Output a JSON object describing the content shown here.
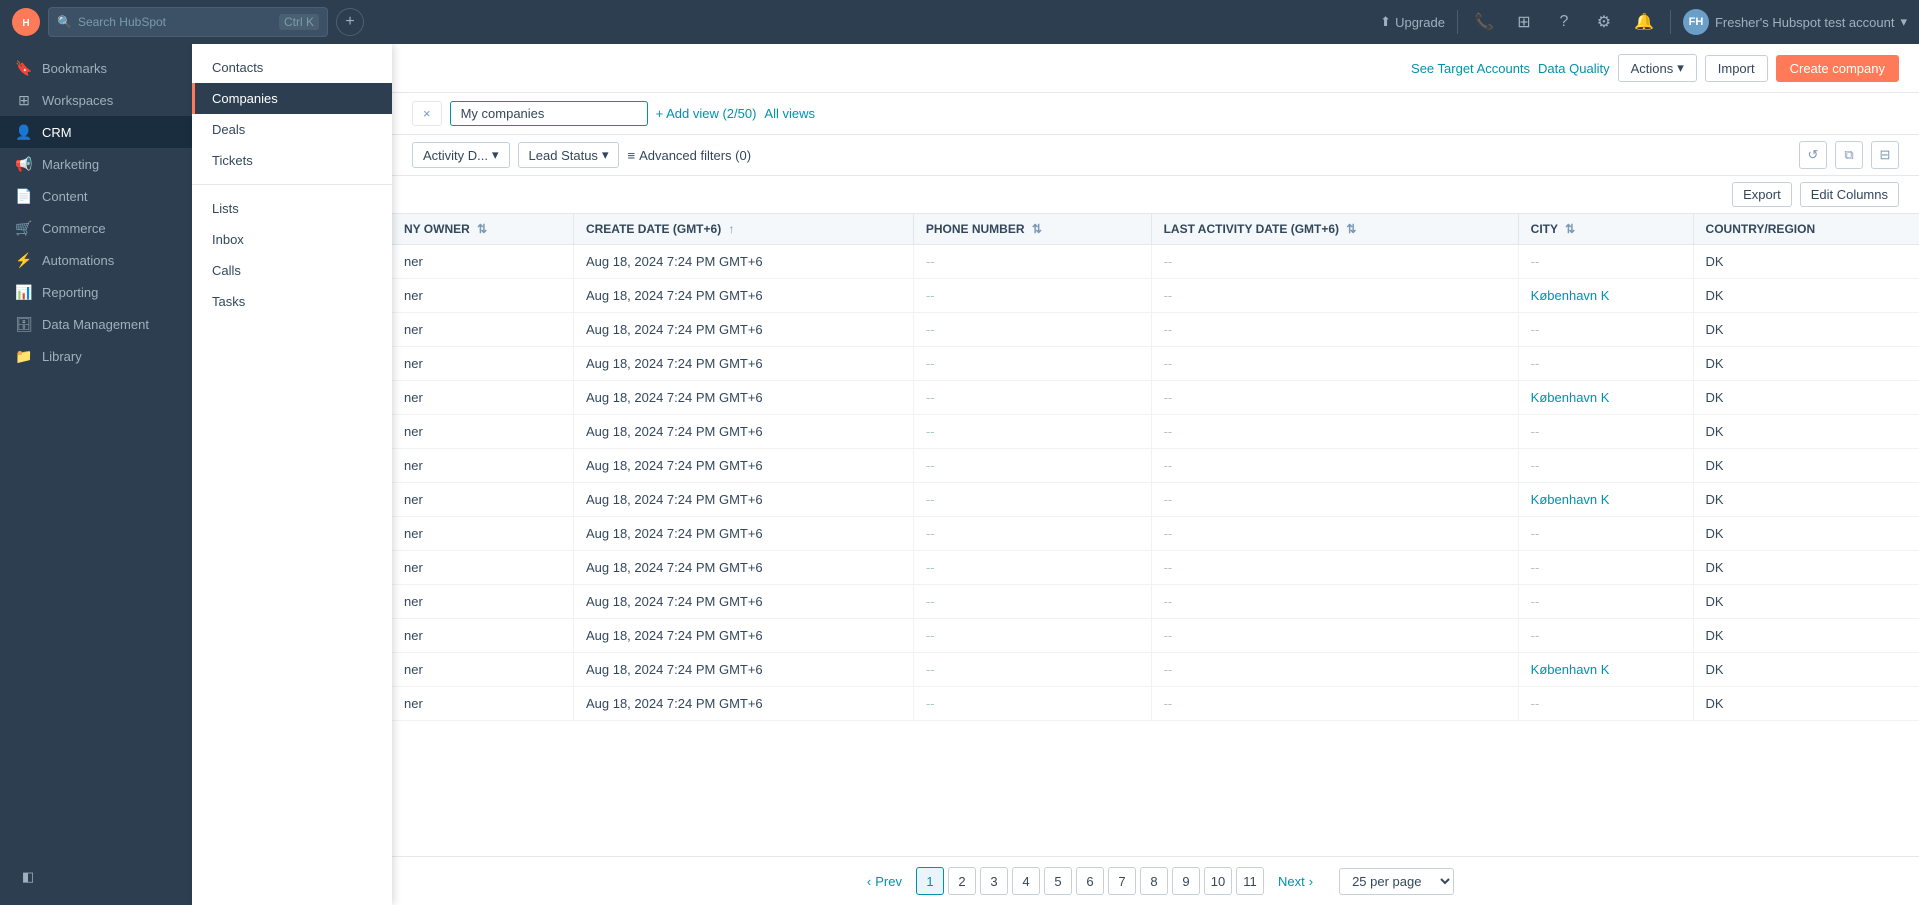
{
  "topNav": {
    "logo": "H",
    "search_placeholder": "Search HubSpot",
    "shortcut": "Ctrl K",
    "upgrade_label": "Upgrade",
    "user_label": "Fresher's Hubspot test account",
    "user_initials": "FH"
  },
  "sidebar": {
    "items": [
      {
        "id": "bookmarks",
        "label": "Bookmarks",
        "icon": "🔖"
      },
      {
        "id": "workspaces",
        "label": "Workspaces",
        "icon": "⊞"
      },
      {
        "id": "crm",
        "label": "CRM",
        "icon": "👤",
        "active": true
      },
      {
        "id": "marketing",
        "label": "Marketing",
        "icon": "📢"
      },
      {
        "id": "content",
        "label": "Content",
        "icon": "📄"
      },
      {
        "id": "commerce",
        "label": "Commerce",
        "icon": "🛒"
      },
      {
        "id": "automations",
        "label": "Automations",
        "icon": "⚡"
      },
      {
        "id": "reporting",
        "label": "Reporting",
        "icon": "📊"
      },
      {
        "id": "data-management",
        "label": "Data Management",
        "icon": "🗄"
      },
      {
        "id": "library",
        "label": "Library",
        "icon": "📁"
      }
    ]
  },
  "dropdown": {
    "items": [
      {
        "id": "contacts",
        "label": "Contacts",
        "active": false
      },
      {
        "id": "companies",
        "label": "Companies",
        "active": true
      },
      {
        "id": "deals",
        "label": "Deals",
        "active": false
      },
      {
        "id": "tickets",
        "label": "Tickets",
        "active": false
      },
      {
        "id": "lists",
        "label": "Lists",
        "active": false
      },
      {
        "id": "inbox",
        "label": "Inbox",
        "active": false
      },
      {
        "id": "calls",
        "label": "Calls",
        "active": false
      },
      {
        "id": "tasks",
        "label": "Tasks",
        "active": false
      }
    ]
  },
  "toolbar": {
    "see_target_label": "See Target Accounts",
    "data_quality_label": "Data Quality",
    "actions_label": "Actions",
    "import_label": "Import",
    "create_company_label": "Create company"
  },
  "filterBar": {
    "close_icon": "×",
    "view_name": "My companies",
    "add_view_label": "+ Add view (2/50)",
    "all_views_label": "All views"
  },
  "filterChips": {
    "activity_filter": "Activity D...",
    "lead_status_filter": "Lead Status",
    "advanced_filter": "Advanced filters (0)"
  },
  "tableToolbar": {
    "export_label": "Export",
    "edit_columns_label": "Edit Columns"
  },
  "table": {
    "columns": [
      {
        "id": "owner",
        "label": "NY OWNER",
        "sortable": true,
        "sorted": false
      },
      {
        "id": "create_date",
        "label": "CREATE DATE (GMT+6)",
        "sortable": true,
        "sorted": true
      },
      {
        "id": "phone",
        "label": "PHONE NUMBER",
        "sortable": true,
        "sorted": false
      },
      {
        "id": "last_activity",
        "label": "LAST ACTIVITY DATE (GMT+6)",
        "sortable": true,
        "sorted": false
      },
      {
        "id": "city",
        "label": "CITY",
        "sortable": true,
        "sorted": false
      },
      {
        "id": "country",
        "label": "COUNTRY/REGION",
        "sortable": false,
        "sorted": false
      }
    ],
    "rows": [
      {
        "owner": "ner",
        "create_date": "Aug 18, 2024 7:24 PM GMT+6",
        "phone": "--",
        "last_activity": "--",
        "city": "--",
        "country": "DK"
      },
      {
        "owner": "ner",
        "create_date": "Aug 18, 2024 7:24 PM GMT+6",
        "phone": "--",
        "last_activity": "--",
        "city": "København K",
        "city_link": true,
        "country": "DK"
      },
      {
        "owner": "ner",
        "create_date": "Aug 18, 2024 7:24 PM GMT+6",
        "phone": "--",
        "last_activity": "--",
        "city": "--",
        "country": "DK"
      },
      {
        "owner": "ner",
        "create_date": "Aug 18, 2024 7:24 PM GMT+6",
        "phone": "--",
        "last_activity": "--",
        "city": "--",
        "country": "DK"
      },
      {
        "owner": "ner",
        "create_date": "Aug 18, 2024 7:24 PM GMT+6",
        "phone": "--",
        "last_activity": "--",
        "city": "København K",
        "city_link": true,
        "country": "DK"
      },
      {
        "owner": "ner",
        "create_date": "Aug 18, 2024 7:24 PM GMT+6",
        "phone": "--",
        "last_activity": "--",
        "city": "--",
        "country": "DK"
      },
      {
        "owner": "ner",
        "create_date": "Aug 18, 2024 7:24 PM GMT+6",
        "phone": "--",
        "last_activity": "--",
        "city": "--",
        "country": "DK"
      },
      {
        "owner": "ner",
        "create_date": "Aug 18, 2024 7:24 PM GMT+6",
        "phone": "--",
        "last_activity": "--",
        "city": "København K",
        "city_link": true,
        "country": "DK"
      },
      {
        "owner": "ner",
        "create_date": "Aug 18, 2024 7:24 PM GMT+6",
        "phone": "--",
        "last_activity": "--",
        "city": "--",
        "country": "DK"
      },
      {
        "owner": "ner",
        "create_date": "Aug 18, 2024 7:24 PM GMT+6",
        "phone": "--",
        "last_activity": "--",
        "city": "--",
        "country": "DK"
      },
      {
        "owner": "ner",
        "create_date": "Aug 18, 2024 7:24 PM GMT+6",
        "phone": "--",
        "last_activity": "--",
        "city": "--",
        "country": "DK"
      },
      {
        "owner": "ner",
        "create_date": "Aug 18, 2024 7:24 PM GMT+6",
        "phone": "--",
        "last_activity": "--",
        "city": "--",
        "country": "DK"
      },
      {
        "owner": "ner",
        "create_date": "Aug 18, 2024 7:24 PM GMT+6",
        "phone": "--",
        "last_activity": "--",
        "city": "København K",
        "city_link": true,
        "country": "DK"
      },
      {
        "owner": "ner",
        "create_date": "Aug 18, 2024 7:24 PM GMT+6",
        "phone": "--",
        "last_activity": "--",
        "city": "--",
        "country": "DK"
      }
    ]
  },
  "pagination": {
    "prev_label": "Prev",
    "next_label": "Next",
    "current_page": 1,
    "pages": [
      1,
      2,
      3,
      4,
      5,
      6,
      7,
      8,
      9,
      10,
      11
    ],
    "per_page_label": "25 per page"
  }
}
